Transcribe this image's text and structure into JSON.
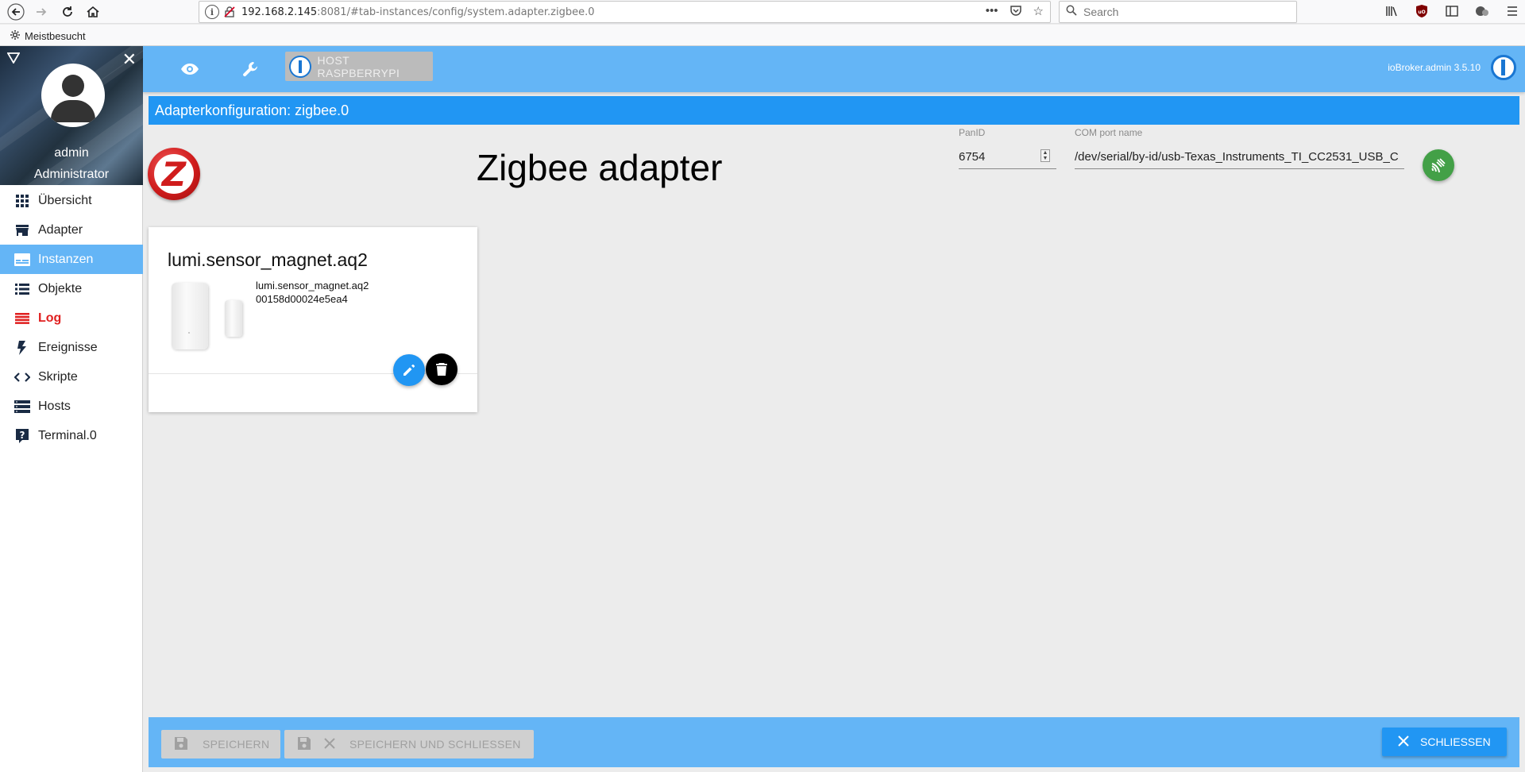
{
  "browser": {
    "url_host": "192.168.2.145",
    "url_rest": ":8081/#tab-instances/config/system.adapter.zigbee.0",
    "search_placeholder": "Search",
    "bookmark_label": "Meistbesucht"
  },
  "sidebar": {
    "user_name": "admin",
    "user_role": "Administrator",
    "items": [
      {
        "label": "Übersicht",
        "icon": "grid-icon"
      },
      {
        "label": "Adapter",
        "icon": "store-icon"
      },
      {
        "label": "Instanzen",
        "icon": "instances-icon",
        "active": true
      },
      {
        "label": "Objekte",
        "icon": "list-icon"
      },
      {
        "label": "Log",
        "icon": "log-icon"
      },
      {
        "label": "Ereignisse",
        "icon": "bolt-icon"
      },
      {
        "label": "Skripte",
        "icon": "code-icon"
      },
      {
        "label": "Hosts",
        "icon": "hosts-icon"
      },
      {
        "label": "Terminal.0",
        "icon": "help-icon"
      }
    ]
  },
  "appbar": {
    "host_label": "HOST RASPBERRYPI",
    "version": "ioBroker.admin 3.5.10"
  },
  "config": {
    "title": "Adapterkonfiguration: zigbee.0",
    "heading": "Zigbee adapter",
    "panid_label": "PanID",
    "panid_value": "6754",
    "com_label": "COM port name",
    "com_value": "/dev/serial/by-id/usb-Texas_Instruments_TI_CC2531_USB_C"
  },
  "device_card": {
    "title": "lumi.sensor_magnet.aq2",
    "model": "lumi.sensor_magnet.aq2",
    "ieee": "00158d00024e5ea4"
  },
  "footer": {
    "save_label": "SPEICHERN",
    "save_close_label": "SPEICHERN UND SCHLIESSEN",
    "close_label": "SCHLIESSEN"
  },
  "colors": {
    "appbar": "#64b5f6",
    "title_bar": "#2196f3",
    "active_nav": "#64b5f6",
    "log": "#e02020",
    "scan_button": "#43a047"
  }
}
